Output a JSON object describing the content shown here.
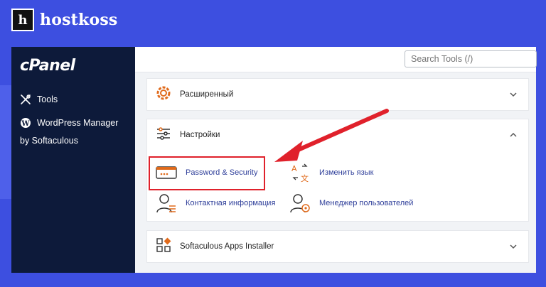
{
  "brand": {
    "mark": "h",
    "name": "hostkoss"
  },
  "cpanel": {
    "logo": "cPanel"
  },
  "sidebar": {
    "items": [
      {
        "label": "Tools",
        "icon": "tools-icon"
      },
      {
        "label": "WordPress Manager",
        "icon": "wordpress-icon"
      }
    ],
    "wp_sub": "by Softaculous"
  },
  "search": {
    "placeholder": "Search Tools (/)"
  },
  "sections": {
    "advanced": {
      "title": "Расширенный",
      "expanded": false
    },
    "preferences": {
      "title": "Настройки",
      "expanded": true,
      "items": [
        {
          "label": "Password & Security",
          "icon": "password-icon"
        },
        {
          "label": "Изменить язык",
          "icon": "language-icon"
        },
        {
          "label": "Контактная информация",
          "icon": "contact-icon"
        },
        {
          "label": "Менеджер пользователей",
          "icon": "user-manager-icon"
        }
      ]
    },
    "softaculous": {
      "title": "Softaculous Apps Installer",
      "expanded": false
    }
  },
  "colors": {
    "background": "#3d4fe0",
    "sidebar": "#0d1a3a",
    "highlight": "#e0212b",
    "link": "#2f3f9a",
    "advanced_icon": "#e06a1b"
  }
}
